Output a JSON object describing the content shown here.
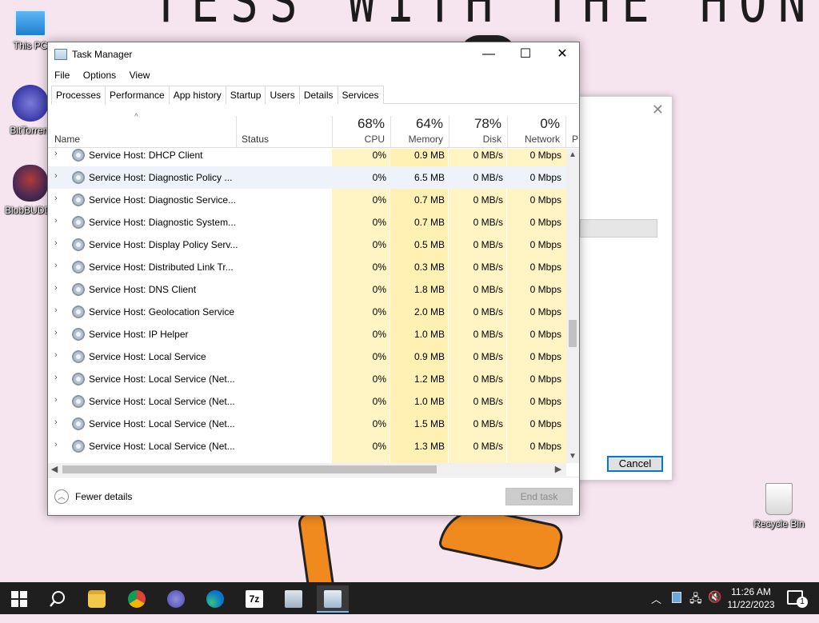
{
  "desktop": {
    "wallpaper_text": "TESS WITH THE HONK",
    "icons": [
      {
        "label": "This PC"
      },
      {
        "label": "BitTorrent"
      },
      {
        "label": "BlobBUDDY"
      },
      {
        "label": "Recycle Bin"
      }
    ],
    "background_dialog": {
      "cancel_label": "Cancel",
      "close_glyph": "✕"
    }
  },
  "window": {
    "title": "Task Manager",
    "controls": {
      "minimize": "—",
      "maximize": "☐",
      "close": "✕"
    },
    "menu": [
      "File",
      "Options",
      "View"
    ],
    "tabs": [
      "Processes",
      "Performance",
      "App history",
      "Startup",
      "Users",
      "Details",
      "Services"
    ],
    "active_tab": "Processes"
  },
  "columns": {
    "name": "Name",
    "status": "Status",
    "sort_glyph": "^",
    "cpu": {
      "pct": "68%",
      "label": "CPU"
    },
    "memory": {
      "pct": "64%",
      "label": "Memory"
    },
    "disk": {
      "pct": "78%",
      "label": "Disk"
    },
    "network": {
      "pct": "0%",
      "label": "Network"
    },
    "power": {
      "label": "P"
    }
  },
  "processes": [
    {
      "name": "Service Host: DHCP Client",
      "cpu": "0%",
      "memory": "0.9 MB",
      "disk": "0 MB/s",
      "network": "0 Mbps"
    },
    {
      "name": "Service Host: Diagnostic Policy ...",
      "cpu": "0%",
      "memory": "6.5 MB",
      "disk": "0 MB/s",
      "network": "0 Mbps"
    },
    {
      "name": "Service Host: Diagnostic Service...",
      "cpu": "0%",
      "memory": "0.7 MB",
      "disk": "0 MB/s",
      "network": "0 Mbps"
    },
    {
      "name": "Service Host: Diagnostic System...",
      "cpu": "0%",
      "memory": "0.7 MB",
      "disk": "0 MB/s",
      "network": "0 Mbps"
    },
    {
      "name": "Service Host: Display Policy Serv...",
      "cpu": "0%",
      "memory": "0.5 MB",
      "disk": "0 MB/s",
      "network": "0 Mbps"
    },
    {
      "name": "Service Host: Distributed Link Tr...",
      "cpu": "0%",
      "memory": "0.3 MB",
      "disk": "0 MB/s",
      "network": "0 Mbps"
    },
    {
      "name": "Service Host: DNS Client",
      "cpu": "0%",
      "memory": "1.8 MB",
      "disk": "0 MB/s",
      "network": "0 Mbps"
    },
    {
      "name": "Service Host: Geolocation Service",
      "cpu": "0%",
      "memory": "2.0 MB",
      "disk": "0 MB/s",
      "network": "0 Mbps"
    },
    {
      "name": "Service Host: IP Helper",
      "cpu": "0%",
      "memory": "1.0 MB",
      "disk": "0 MB/s",
      "network": "0 Mbps"
    },
    {
      "name": "Service Host: Local Service",
      "cpu": "0%",
      "memory": "0.9 MB",
      "disk": "0 MB/s",
      "network": "0 Mbps"
    },
    {
      "name": "Service Host: Local Service (Net...",
      "cpu": "0%",
      "memory": "1.2 MB",
      "disk": "0 MB/s",
      "network": "0 Mbps"
    },
    {
      "name": "Service Host: Local Service (Net...",
      "cpu": "0%",
      "memory": "1.0 MB",
      "disk": "0 MB/s",
      "network": "0 Mbps"
    },
    {
      "name": "Service Host: Local Service (Net...",
      "cpu": "0%",
      "memory": "1.5 MB",
      "disk": "0 MB/s",
      "network": "0 Mbps"
    },
    {
      "name": "Service Host: Local Service (Net...",
      "cpu": "0%",
      "memory": "1.3 MB",
      "disk": "0 MB/s",
      "network": "0 Mbps"
    }
  ],
  "footer": {
    "fewer_details": "Fewer details",
    "end_task": "End task"
  },
  "taskbar": {
    "items": [
      "start-icon",
      "search-icon",
      "file-explorer-icon",
      "chrome-icon",
      "bittorrent-icon",
      "edge-icon",
      "7zip-icon",
      "app-icon",
      "task-manager-icon"
    ],
    "clock_time": "11:26 AM",
    "clock_date": "11/22/2023",
    "notification_count": "1"
  },
  "colors": {
    "heat_yellow": "#fff4c4",
    "accent": "#0078d7",
    "taskbar": "#1f1f1f"
  }
}
